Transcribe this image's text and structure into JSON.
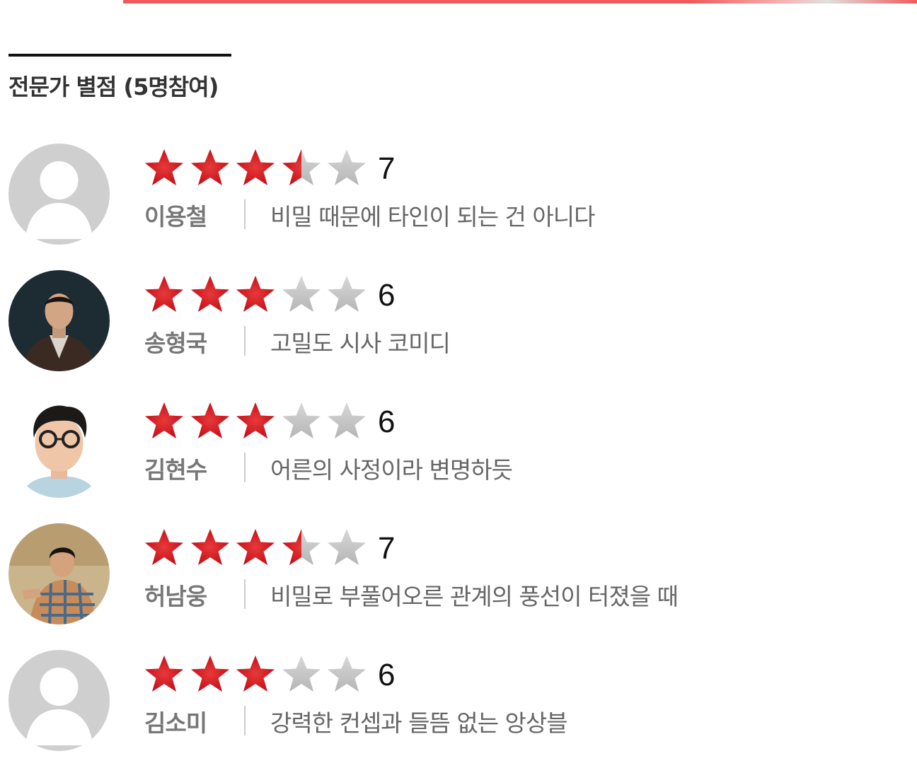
{
  "section": {
    "title": "전문가 별점 (5명참여)"
  },
  "colors": {
    "accent": "#f05a5a",
    "star_on": "#c8101a",
    "star_off": "#b5b5b5"
  },
  "reviews": [
    {
      "name": "이용철",
      "score": "7",
      "comment": "비밀 때문에 타인이 되는 건 아니다",
      "rating_out_of_5": 3.5,
      "avatar": "placeholder"
    },
    {
      "name": "송형국",
      "score": "6",
      "comment": "고밀도 시사 코미디",
      "rating_out_of_5": 3,
      "avatar": "photo-dark-background-man"
    },
    {
      "name": "김현수",
      "score": "6",
      "comment": "어른의 사정이라 변명하듯",
      "rating_out_of_5": 3,
      "avatar": "photo-man-glasses"
    },
    {
      "name": "허남웅",
      "score": "7",
      "comment": "비밀로 부풀어오른 관계의 풍선이 터졌을 때",
      "rating_out_of_5": 3.5,
      "avatar": "photo-man-plaid-shirt"
    },
    {
      "name": "김소미",
      "score": "6",
      "comment": "강력한 컨셉과 들뜸 없는 앙상블",
      "rating_out_of_5": 3,
      "avatar": "placeholder"
    }
  ]
}
